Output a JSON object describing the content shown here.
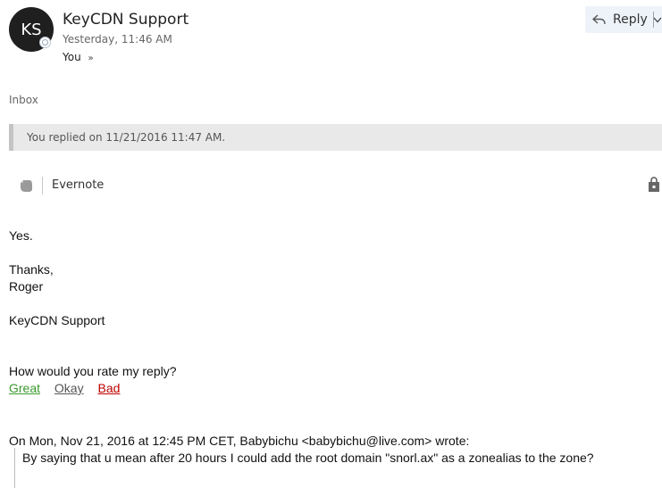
{
  "header": {
    "avatar_initials": "KS",
    "sender": "KeyCDN Support",
    "time": "Yesterday, 11:46 AM",
    "recipient": "You",
    "reply_label": "Reply"
  },
  "folder": "Inbox",
  "replied_notice": "You replied on 11/21/2016 11:47 AM.",
  "addin": {
    "label": "Evernote"
  },
  "body": {
    "line1": "Yes.",
    "thanks": "Thanks,",
    "name": "Roger",
    "signature": "KeyCDN Support",
    "rate_question": "How would you rate my reply?",
    "rate_great": "Great",
    "rate_okay": "Okay",
    "rate_bad": "Bad",
    "quote_header": "On Mon, Nov 21, 2016 at 12:45 PM CET, Babybichu <babybichu@live.com> wrote:",
    "quote_text": "By saying that u mean after 20 hours I could add the root domain \"snorl.ax\" as a zonealias to the zone?"
  },
  "colors": {
    "great": "#3a9a2e",
    "okay": "#555555",
    "bad": "#c00000",
    "reply_bg": "#eef3f9",
    "notice_bg": "#e9e9e9"
  },
  "icons": [
    "reply-icon",
    "chevron-down-icon",
    "double-chevron-down-icon",
    "evernote-icon",
    "store-bag-icon",
    "presence-icon"
  ]
}
